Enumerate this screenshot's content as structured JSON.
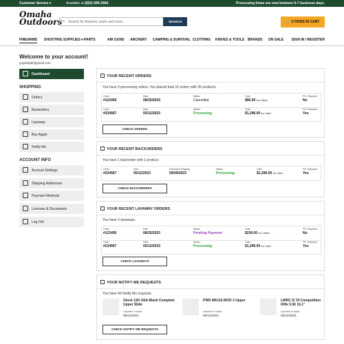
{
  "topbar": {
    "customer_service": "Customer Service ▾",
    "available_label": "Available at",
    "phone": "(832) 699-2666",
    "notice": "Processing times are now between 5-7 business days."
  },
  "header": {
    "logo_line1": "Omaha",
    "logo_line2": "Outdoors",
    "search_placeholder": "Search for firearms, parts and more...",
    "search_button": "SEARCH",
    "cart_label": "3 ITEMS IN CART"
  },
  "nav": {
    "items": [
      "FIREARMS",
      "SHOOTING SUPPLIES ▾",
      "PARTS",
      "AIR GUNS",
      "ARCHERY",
      "CAMPING & SURVIVAL",
      "CLOTHING",
      "KNIVES & TOOLS",
      "BRANDS",
      "ON SALE"
    ],
    "signin": "SIGN IN / REGISTER"
  },
  "account": {
    "welcome": "Welcome to your account!",
    "email": "gogadsjak@gmail.com"
  },
  "sidebar": {
    "dashboard": "Dashboard",
    "shopping_heading": "SHOPPING",
    "shopping": [
      "Orders",
      "Backorders",
      "Layaway",
      "Buy Again",
      "Notify Me"
    ],
    "account_heading": "ACCOUNT INFO",
    "account": [
      "Account Settings",
      "Shipping Addresses",
      "Payment Methods",
      "Licenses & Documents",
      "Log Out"
    ]
  },
  "orders": {
    "title": "YOUR RECENT ORDERS",
    "summary": "You have 3 processing orders. You placed total 15 orders with 35 products.",
    "labels": {
      "order": "Order",
      "date": "Date",
      "status": "Status",
      "total": "Total",
      "ffl": "FFL Required"
    },
    "rows": [
      {
        "order": "#123456",
        "date": "08/25/2023",
        "status": "Cancelled",
        "total": "$96.00",
        "items": "for 2 items",
        "ffl": "No"
      },
      {
        "order": "#234567",
        "date": "05/12/2023",
        "status": "Processing",
        "total": "$1,296.00",
        "items": "for 1 item",
        "ffl": "Yes"
      }
    ],
    "button": "CHECK ORDERS"
  },
  "backorders": {
    "title": "YOUR RECENT BACKORDERS",
    "summary": "You have 1 backorder with 1 product.",
    "labels": {
      "order": "Order",
      "date": "Date",
      "shipping": "Estimated Shipping",
      "status": "Status",
      "total": "Total",
      "ffl": "FFL Required"
    },
    "rows": [
      {
        "order": "#234567",
        "date": "05/12/2023",
        "shipping": "09/09/2023",
        "status": "Processing",
        "total": "$1,296.00",
        "items": "for 1 item",
        "ffl": "Yes"
      }
    ],
    "button": "CHECK BACKORDERS"
  },
  "layaways": {
    "title": "YOUR RECENT LAYAWAY ORDERS",
    "summary": "You have 3 layaways.",
    "labels": {
      "order": "Order",
      "date": "Date",
      "status": "Status",
      "total": "Total",
      "ffl": "FFL Required"
    },
    "rows": [
      {
        "order": "#123456",
        "date": "08/25/2023",
        "status": "Pending Payment",
        "total": "$236.00",
        "items": "for 2 items",
        "ffl": "No"
      },
      {
        "order": "#234567",
        "date": "05/12/2023",
        "status": "Processing",
        "total": "$1,296.00",
        "items": "for 1 item",
        "ffl": "Yes"
      }
    ],
    "button": "CHECK LAYAWAYS"
  },
  "notify": {
    "title": "YOUR NOTIFY ME REQUESTS",
    "summary": "You have 46 Notify Me requests.",
    "stock_label": "Last time in stock:",
    "products": [
      {
        "name": "Glock 19X USA Black Complete Upper Slide",
        "date": "05/12/2023"
      },
      {
        "name": "PWS MK116 MOD 2 Upper",
        "date": "05/12/2023"
      },
      {
        "name": "LWRC IC DI Competition Rifle 5.56 16.1\"",
        "date": "05/12/2023"
      }
    ],
    "button": "CHECK NOTIFY ME REQUESTS"
  },
  "colors": {
    "brand_green": "#1e4a2e",
    "accent": "#f5a623",
    "processing": "#2a9d3a",
    "pending": "#a23bc7"
  }
}
